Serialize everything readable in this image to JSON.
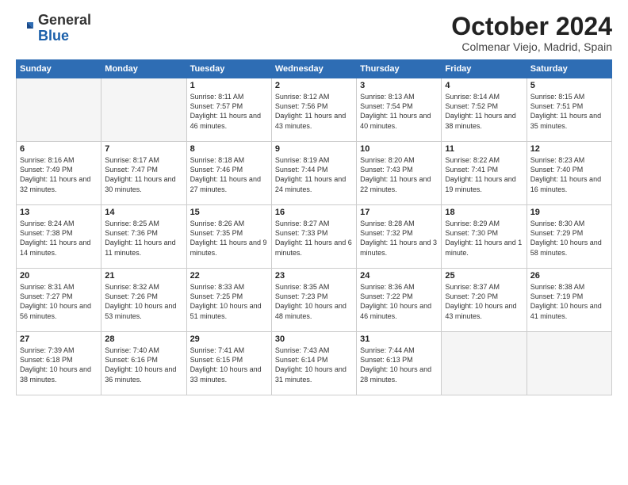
{
  "header": {
    "logo_general": "General",
    "logo_blue": "Blue",
    "month_year": "October 2024",
    "location": "Colmenar Viejo, Madrid, Spain"
  },
  "days_of_week": [
    "Sunday",
    "Monday",
    "Tuesday",
    "Wednesday",
    "Thursday",
    "Friday",
    "Saturday"
  ],
  "weeks": [
    [
      {
        "day": "",
        "empty": true
      },
      {
        "day": "",
        "empty": true
      },
      {
        "day": "1",
        "sunrise": "8:11 AM",
        "sunset": "7:57 PM",
        "daylight": "11 hours and 46 minutes."
      },
      {
        "day": "2",
        "sunrise": "8:12 AM",
        "sunset": "7:56 PM",
        "daylight": "11 hours and 43 minutes."
      },
      {
        "day": "3",
        "sunrise": "8:13 AM",
        "sunset": "7:54 PM",
        "daylight": "11 hours and 40 minutes."
      },
      {
        "day": "4",
        "sunrise": "8:14 AM",
        "sunset": "7:52 PM",
        "daylight": "11 hours and 38 minutes."
      },
      {
        "day": "5",
        "sunrise": "8:15 AM",
        "sunset": "7:51 PM",
        "daylight": "11 hours and 35 minutes."
      }
    ],
    [
      {
        "day": "6",
        "sunrise": "8:16 AM",
        "sunset": "7:49 PM",
        "daylight": "11 hours and 32 minutes."
      },
      {
        "day": "7",
        "sunrise": "8:17 AM",
        "sunset": "7:47 PM",
        "daylight": "11 hours and 30 minutes."
      },
      {
        "day": "8",
        "sunrise": "8:18 AM",
        "sunset": "7:46 PM",
        "daylight": "11 hours and 27 minutes."
      },
      {
        "day": "9",
        "sunrise": "8:19 AM",
        "sunset": "7:44 PM",
        "daylight": "11 hours and 24 minutes."
      },
      {
        "day": "10",
        "sunrise": "8:20 AM",
        "sunset": "7:43 PM",
        "daylight": "11 hours and 22 minutes."
      },
      {
        "day": "11",
        "sunrise": "8:22 AM",
        "sunset": "7:41 PM",
        "daylight": "11 hours and 19 minutes."
      },
      {
        "day": "12",
        "sunrise": "8:23 AM",
        "sunset": "7:40 PM",
        "daylight": "11 hours and 16 minutes."
      }
    ],
    [
      {
        "day": "13",
        "sunrise": "8:24 AM",
        "sunset": "7:38 PM",
        "daylight": "11 hours and 14 minutes."
      },
      {
        "day": "14",
        "sunrise": "8:25 AM",
        "sunset": "7:36 PM",
        "daylight": "11 hours and 11 minutes."
      },
      {
        "day": "15",
        "sunrise": "8:26 AM",
        "sunset": "7:35 PM",
        "daylight": "11 hours and 9 minutes."
      },
      {
        "day": "16",
        "sunrise": "8:27 AM",
        "sunset": "7:33 PM",
        "daylight": "11 hours and 6 minutes."
      },
      {
        "day": "17",
        "sunrise": "8:28 AM",
        "sunset": "7:32 PM",
        "daylight": "11 hours and 3 minutes."
      },
      {
        "day": "18",
        "sunrise": "8:29 AM",
        "sunset": "7:30 PM",
        "daylight": "11 hours and 1 minute."
      },
      {
        "day": "19",
        "sunrise": "8:30 AM",
        "sunset": "7:29 PM",
        "daylight": "10 hours and 58 minutes."
      }
    ],
    [
      {
        "day": "20",
        "sunrise": "8:31 AM",
        "sunset": "7:27 PM",
        "daylight": "10 hours and 56 minutes."
      },
      {
        "day": "21",
        "sunrise": "8:32 AM",
        "sunset": "7:26 PM",
        "daylight": "10 hours and 53 minutes."
      },
      {
        "day": "22",
        "sunrise": "8:33 AM",
        "sunset": "7:25 PM",
        "daylight": "10 hours and 51 minutes."
      },
      {
        "day": "23",
        "sunrise": "8:35 AM",
        "sunset": "7:23 PM",
        "daylight": "10 hours and 48 minutes."
      },
      {
        "day": "24",
        "sunrise": "8:36 AM",
        "sunset": "7:22 PM",
        "daylight": "10 hours and 46 minutes."
      },
      {
        "day": "25",
        "sunrise": "8:37 AM",
        "sunset": "7:20 PM",
        "daylight": "10 hours and 43 minutes."
      },
      {
        "day": "26",
        "sunrise": "8:38 AM",
        "sunset": "7:19 PM",
        "daylight": "10 hours and 41 minutes."
      }
    ],
    [
      {
        "day": "27",
        "sunrise": "7:39 AM",
        "sunset": "6:18 PM",
        "daylight": "10 hours and 38 minutes."
      },
      {
        "day": "28",
        "sunrise": "7:40 AM",
        "sunset": "6:16 PM",
        "daylight": "10 hours and 36 minutes."
      },
      {
        "day": "29",
        "sunrise": "7:41 AM",
        "sunset": "6:15 PM",
        "daylight": "10 hours and 33 minutes."
      },
      {
        "day": "30",
        "sunrise": "7:43 AM",
        "sunset": "6:14 PM",
        "daylight": "10 hours and 31 minutes."
      },
      {
        "day": "31",
        "sunrise": "7:44 AM",
        "sunset": "6:13 PM",
        "daylight": "10 hours and 28 minutes."
      },
      {
        "day": "",
        "empty": true
      },
      {
        "day": "",
        "empty": true
      }
    ]
  ]
}
